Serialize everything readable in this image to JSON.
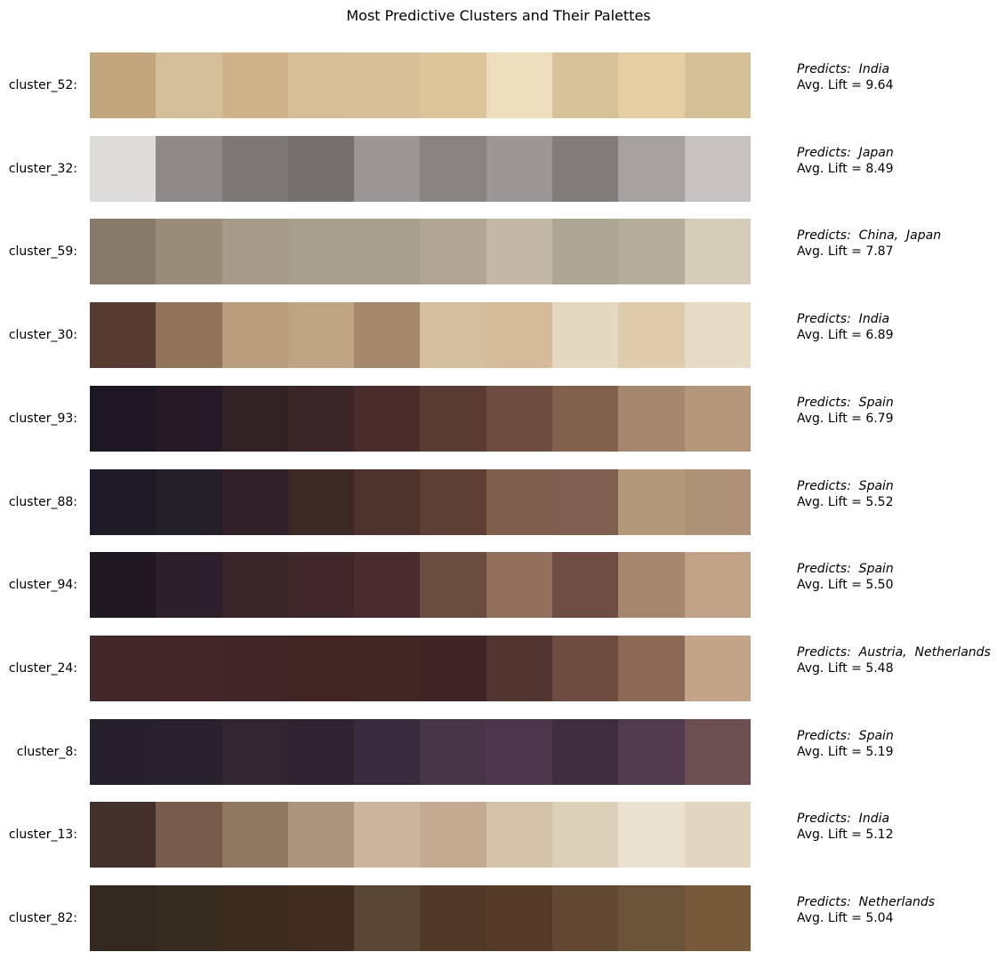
{
  "chart_data": {
    "type": "heatmap",
    "title": "Most Predictive Clusters and Their Palettes",
    "predicts_prefix": "Predicts:",
    "lift_prefix": "Avg. Lift =",
    "rows": [
      {
        "label": "cluster_52:",
        "predicts": [
          "India"
        ],
        "avg_lift": "9.64",
        "colors": [
          "#c1a57c",
          "#d5be9b",
          "#cfb28a",
          "#d6be96",
          "#d8bf98",
          "#ddc59b",
          "#ecdebd",
          "#d7c199",
          "#e5cea4",
          "#d5c097"
        ]
      },
      {
        "label": "cluster_32:",
        "predicts": [
          "Japan"
        ],
        "avg_lift": "8.49",
        "colors": [
          "#dedbdb",
          "#8f8a89",
          "#7c7675",
          "#756f6d",
          "#9b9695",
          "#888281",
          "#9b9695",
          "#827c7b",
          "#a7a2a2",
          "#c7c2c2"
        ]
      },
      {
        "label": "cluster_59:",
        "predicts": [
          "China",
          "Japan"
        ],
        "avg_lift": "7.87",
        "colors": [
          "#877a6b",
          "#9a8c7b",
          "#a69b8a",
          "#a89e8d",
          "#a89e8e",
          "#b1a695",
          "#c3b7a7",
          "#aea694",
          "#b5ad9b",
          "#d5cbb9"
        ]
      },
      {
        "label": "cluster_30:",
        "predicts": [
          "India"
        ],
        "avg_lift": "6.89",
        "colors": [
          "#573b30",
          "#907358",
          "#b89c7b",
          "#bfa483",
          "#a5886b",
          "#d3be9e",
          "#d5bb9a",
          "#e4d8c1",
          "#decbab",
          "#e6dbc4"
        ]
      },
      {
        "label": "cluster_93:",
        "predicts": [
          "Spain"
        ],
        "avg_lift": "6.79",
        "colors": [
          "#1c1722",
          "#261a26",
          "#302225",
          "#3a2626",
          "#4a2c2d",
          "#5a3c35",
          "#6e4d41",
          "#81614d",
          "#a5876f",
          "#b4977a"
        ]
      },
      {
        "label": "cluster_88:",
        "predicts": [
          "Spain"
        ],
        "avg_lift": "5.52",
        "colors": [
          "#1e1b27",
          "#231f28",
          "#2f2127",
          "#3d2a27",
          "#4e332d",
          "#5d3f35",
          "#7e5d4c",
          "#7f5f50",
          "#b3987a",
          "#ad9278"
        ]
      },
      {
        "label": "cluster_94:",
        "predicts": [
          "Spain"
        ],
        "avg_lift": "5.50",
        "colors": [
          "#1f1823",
          "#2e1f2c",
          "#392529",
          "#40282a",
          "#4a2c2e",
          "#6b4c41",
          "#916f5b",
          "#6e4d44",
          "#a5876e",
          "#c0a387"
        ]
      },
      {
        "label": "cluster_24:",
        "predicts": [
          "Austria",
          "Netherlands"
        ],
        "avg_lift": "5.48",
        "colors": [
          "#432829",
          "#432628",
          "#422627",
          "#412525",
          "#402625",
          "#3f2426",
          "#523430",
          "#6e4c40",
          "#8c6856",
          "#c2a488"
        ]
      },
      {
        "label": "cluster_8:",
        "predicts": [
          "Spain"
        ],
        "avg_lift": "5.19",
        "colors": [
          "#26202c",
          "#29212d",
          "#312632",
          "#312231",
          "#382b3e",
          "#483547",
          "#4e374d",
          "#402e40",
          "#523b4d",
          "#6c4f51"
        ]
      },
      {
        "label": "cluster_13:",
        "predicts": [
          "India"
        ],
        "avg_lift": "5.12",
        "colors": [
          "#42302a",
          "#775c4b",
          "#917862",
          "#ac957c",
          "#c9b69d",
          "#c4aa90",
          "#d4c3a8",
          "#ddd0b9",
          "#ebe1d1",
          "#e2d6c1"
        ]
      },
      {
        "label": "cluster_82:",
        "predicts": [
          "Netherlands"
        ],
        "avg_lift": "5.04",
        "colors": [
          "#33281f",
          "#372c20",
          "#3c2b1e",
          "#412d1f",
          "#5a4634",
          "#4f3826",
          "#563c28",
          "#624833",
          "#6b5339",
          "#775a3a"
        ]
      }
    ]
  }
}
